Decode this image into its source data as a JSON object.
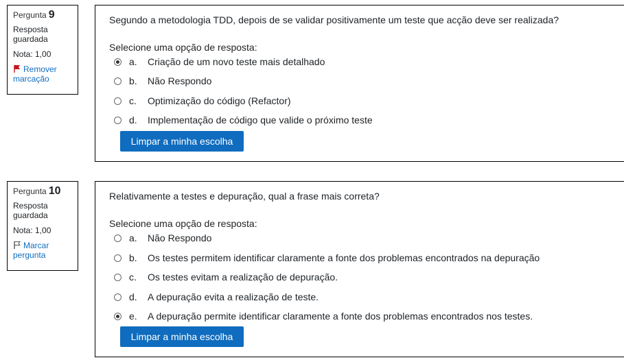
{
  "questions": [
    {
      "label": "Pergunta",
      "number": "9",
      "state": "Resposta guardada",
      "grade": "Nota: 1,00",
      "flag_label": "Remover marcação",
      "flag_color": "#c3161c",
      "flag_icon": "flag-filled-icon",
      "text": "Segundo a metodologia TDD, depois de se validar positivamente um teste que acção deve ser realizada?",
      "prompt": "Selecione uma opção de resposta:",
      "options": [
        {
          "letter": "a.",
          "text": "Criação de um novo teste mais detalhado",
          "selected": true
        },
        {
          "letter": "b.",
          "text": "Não Respondo",
          "selected": false
        },
        {
          "letter": "c.",
          "text": "Optimização do código (Refactor)",
          "selected": false
        },
        {
          "letter": "d.",
          "text": "Implementação de código que valide o próximo teste",
          "selected": false
        }
      ],
      "clear_label": "Limpar a minha escolha"
    },
    {
      "label": "Pergunta",
      "number": "10",
      "state": "Resposta guardada",
      "grade": "Nota: 1,00",
      "flag_label": "Marcar pergunta",
      "flag_color": "#555555",
      "flag_icon": "flag-outline-icon",
      "text": "Relativamente a testes e depuração, qual a frase mais correta?",
      "prompt": "Selecione uma opção de resposta:",
      "options": [
        {
          "letter": "a.",
          "text": "Não Respondo",
          "selected": false
        },
        {
          "letter": "b.",
          "text": "Os testes permitem identificar claramente a fonte dos problemas encontrados na depuração",
          "selected": false
        },
        {
          "letter": "c.",
          "text": "Os testes evitam a realização de depuração.",
          "selected": false
        },
        {
          "letter": "d.",
          "text": "A depuração evita a realização de teste.",
          "selected": false
        },
        {
          "letter": "e.",
          "text": "A depuração permite identificar claramente a fonte dos problemas encontrados nos testes.",
          "selected": true
        }
      ],
      "clear_label": "Limpar a minha escolha"
    }
  ],
  "colors": {
    "accent": "#0f6cbf",
    "text": "#1d2125"
  }
}
